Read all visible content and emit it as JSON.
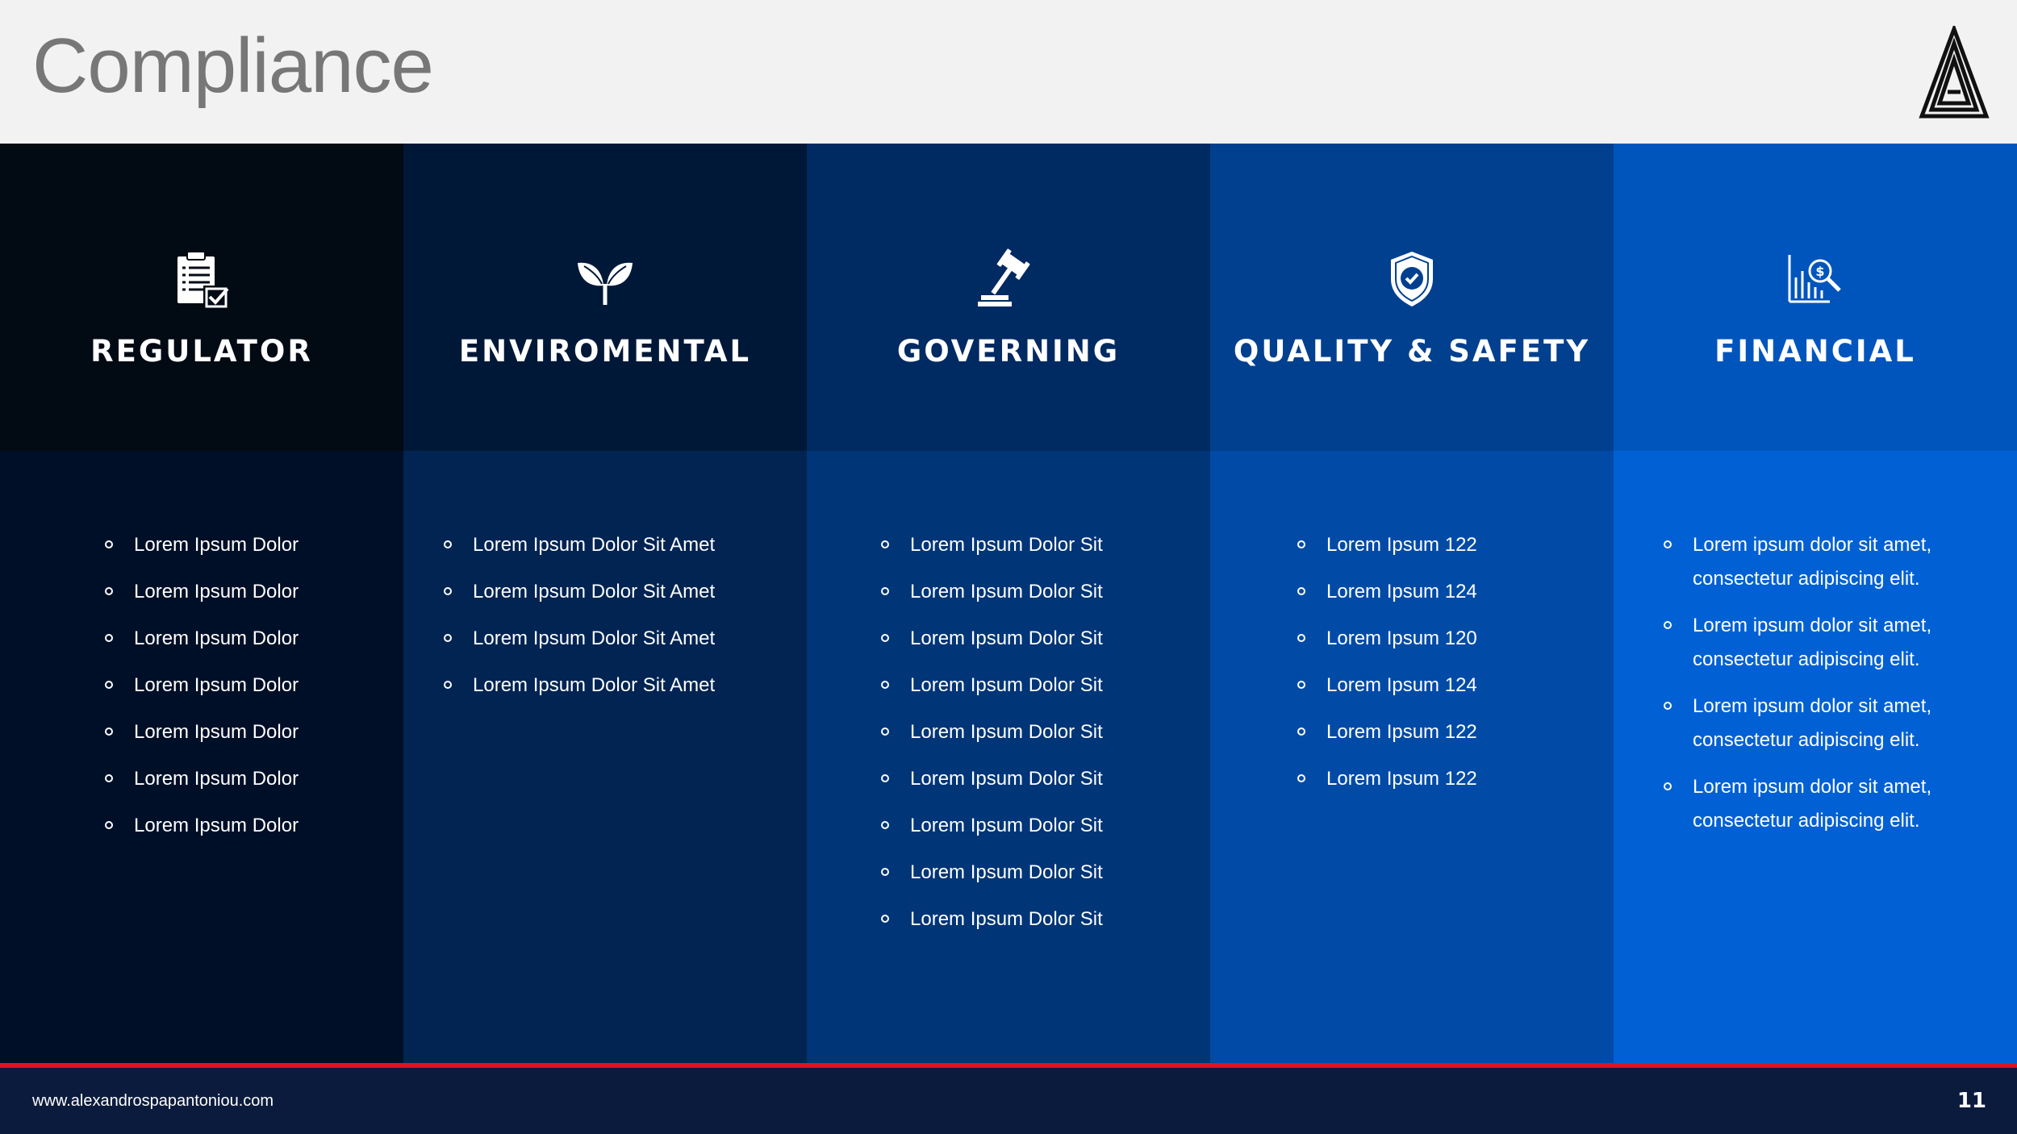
{
  "header": {
    "title": "Compliance",
    "logo_icon": "triangle-a-logo-icon"
  },
  "colors": {
    "col1_top": "#020a14",
    "col1_bottom": "#000f28",
    "col2_top": "#001838",
    "col2_bottom": "#012452",
    "col3_top": "#002a62",
    "col3_bottom": "#003577",
    "col4_top": "#00408f",
    "col4_bottom": "#014ba7",
    "col5_top": "#0055bd",
    "col5_bottom": "#0161d4",
    "accent_line": "#e0141e",
    "footer_bg": "#0b1b3d"
  },
  "columns": [
    {
      "title": "REGULATOR",
      "icon": "clipboard-check-icon",
      "items": [
        "Lorem Ipsum Dolor",
        "Lorem Ipsum Dolor",
        "Lorem Ipsum Dolor",
        "Lorem Ipsum Dolor",
        "Lorem Ipsum Dolor",
        "Lorem Ipsum Dolor",
        "Lorem Ipsum Dolor"
      ]
    },
    {
      "title": "ENVIROMENTAL",
      "icon": "leaf-sprout-icon",
      "items": [
        "Lorem Ipsum Dolor Sit Amet",
        "Lorem Ipsum Dolor Sit Amet",
        "Lorem Ipsum Dolor Sit Amet",
        "Lorem Ipsum Dolor Sit Amet"
      ]
    },
    {
      "title": "GOVERNING",
      "icon": "gavel-icon",
      "items": [
        "Lorem Ipsum Dolor Sit",
        "Lorem Ipsum Dolor Sit",
        "Lorem Ipsum Dolor Sit",
        "Lorem Ipsum Dolor Sit",
        "Lorem Ipsum Dolor Sit",
        "Lorem Ipsum Dolor Sit",
        "Lorem Ipsum Dolor Sit",
        "Lorem Ipsum Dolor Sit",
        "Lorem Ipsum Dolor Sit"
      ]
    },
    {
      "title": "QUALITY & SAFETY",
      "icon": "shield-check-icon",
      "items": [
        "Lorem Ipsum 122",
        "Lorem Ipsum 124",
        "Lorem Ipsum 120",
        "Lorem Ipsum 124",
        "Lorem Ipsum 122",
        "Lorem Ipsum 122"
      ]
    },
    {
      "title": "FINANCIAL",
      "icon": "financial-chart-search-icon",
      "items": [
        "Lorem ipsum dolor sit amet, consectetur adipiscing elit.",
        "Lorem ipsum dolor sit amet, consectetur adipiscing elit.",
        "Lorem ipsum dolor sit amet, consectetur adipiscing elit.",
        "Lorem ipsum dolor sit amet, consectetur adipiscing elit."
      ]
    }
  ],
  "footer": {
    "url": "www.alexandrospapantoniou.com",
    "page_number": "11"
  }
}
